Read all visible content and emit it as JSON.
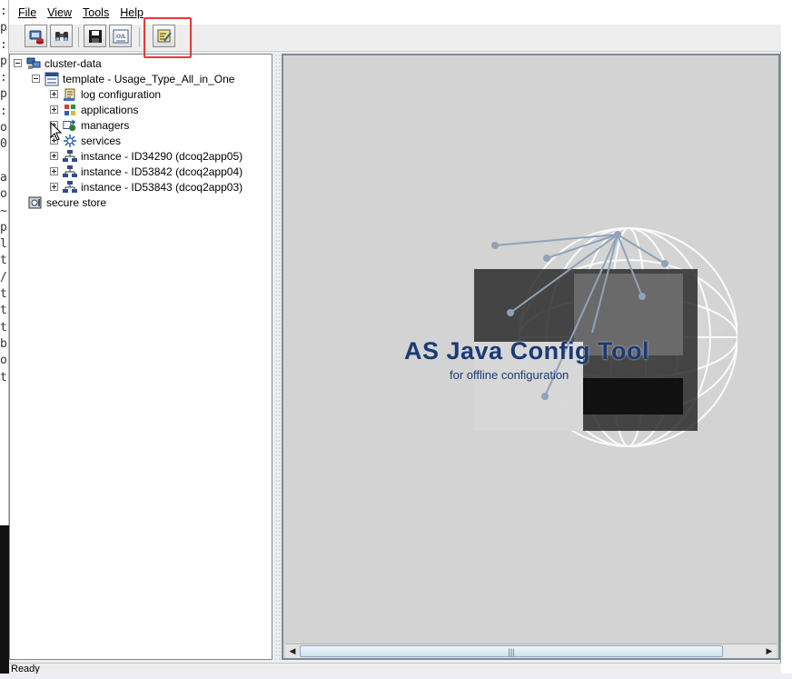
{
  "terminal": {
    "chars": [
      ":",
      "p",
      ":",
      "p",
      ":",
      "p",
      ":",
      "o",
      "0",
      "",
      "a",
      "o",
      "~",
      "p",
      "l",
      "t",
      "/",
      "t",
      "t",
      "t",
      "b",
      "o",
      "t"
    ]
  },
  "menu": {
    "file": "File",
    "view": "View",
    "tools": "Tools",
    "help": "Help"
  },
  "toolbar": {
    "buttons": [
      {
        "name": "connect-db",
        "icon": "database-connect-icon"
      },
      {
        "name": "find",
        "icon": "binoculars-icon"
      },
      {
        "name": "save",
        "icon": "floppy-disk-icon"
      },
      {
        "name": "export-xml",
        "icon": "xml-export-icon",
        "label": "XML"
      },
      {
        "name": "switch-expert-mode",
        "icon": "editor-mode-icon",
        "highlighted": true
      }
    ]
  },
  "tree": {
    "root": "cluster-data",
    "template": "template - Usage_Type_All_in_One",
    "children": [
      "log configuration",
      "applications",
      "managers",
      "services",
      "instance - ID34290 (dcoq2app05)",
      "instance - ID53842 (dcoq2app04)",
      "instance - ID53843 (dcoq2app03)"
    ],
    "secure_store": "secure store"
  },
  "splash": {
    "title": "AS Java Config Tool",
    "subtitle": "for offline configuration"
  },
  "status": {
    "text": "Ready"
  },
  "colors": {
    "highlight": "#e53935",
    "splash_text": "#1b3a74",
    "panel_bg": "#d3d3d3"
  }
}
